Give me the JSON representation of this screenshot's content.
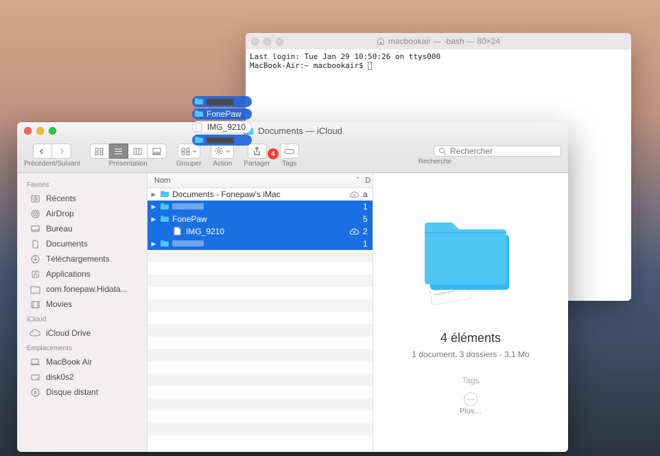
{
  "terminal": {
    "title": "macbookair — -bash — 80×24",
    "line1": "Last login: Tue Jan 29 10:50:26 on ttys000",
    "line2": "MacBook-Air:~ macbookair$ "
  },
  "finder": {
    "title": "Documents — iCloud",
    "toolbar": {
      "back_forward_label": "Précédent/Suivant",
      "view_label": "Présentation",
      "group_label": "Grouper",
      "action_label": "Action",
      "share_label": "Partager",
      "tags_label": "Tags",
      "search_label": "Recherche",
      "search_placeholder": "Rechercher",
      "badge": "4"
    },
    "sidebar": {
      "favoris_header": "Favoris",
      "favoris": [
        "Récents",
        "AirDrop",
        "Bureau",
        "Documents",
        "Téléchargements",
        "Applications",
        "com.fonepaw.Hidata...",
        "Movies"
      ],
      "icloud_header": "iCloud",
      "icloud": [
        "iCloud Drive"
      ],
      "emplacements_header": "Emplacements",
      "emplacements": [
        "MacBook Air",
        "disk0s2",
        "Disque distant"
      ]
    },
    "columns": {
      "name": "Nom",
      "d": "D"
    },
    "rows": [
      {
        "name": "Documents - Fonepaw's iMac",
        "selected": false,
        "cloud": true,
        "trail": "a",
        "type": "folder",
        "disclosure": true
      },
      {
        "name": "",
        "redact": true,
        "selected": true,
        "cloud": false,
        "trail": "1",
        "type": "folder",
        "disclosure": true
      },
      {
        "name": "FonePaw",
        "selected": true,
        "cloud": false,
        "trail": "5",
        "type": "folder",
        "disclosure": true
      },
      {
        "name": "IMG_9210",
        "selected": true,
        "cloud": true,
        "trail": "2",
        "type": "doc",
        "disclosure": false,
        "indent": true
      },
      {
        "name": "",
        "redact": true,
        "selected": true,
        "cloud": false,
        "trail": "1",
        "type": "folder",
        "disclosure": true
      }
    ],
    "preview": {
      "title": "4 éléments",
      "subtitle": "1 document, 3 dossiers - 3,1 Mo",
      "tags_label": "Tags",
      "more_label": "Plus…"
    }
  },
  "drag_ghost": {
    "items": [
      {
        "type": "folder",
        "redact": true
      },
      {
        "type": "folder",
        "label": "FonePaw"
      },
      {
        "type": "doc",
        "label": "IMG_9210"
      },
      {
        "type": "folder",
        "redact": true
      }
    ]
  }
}
